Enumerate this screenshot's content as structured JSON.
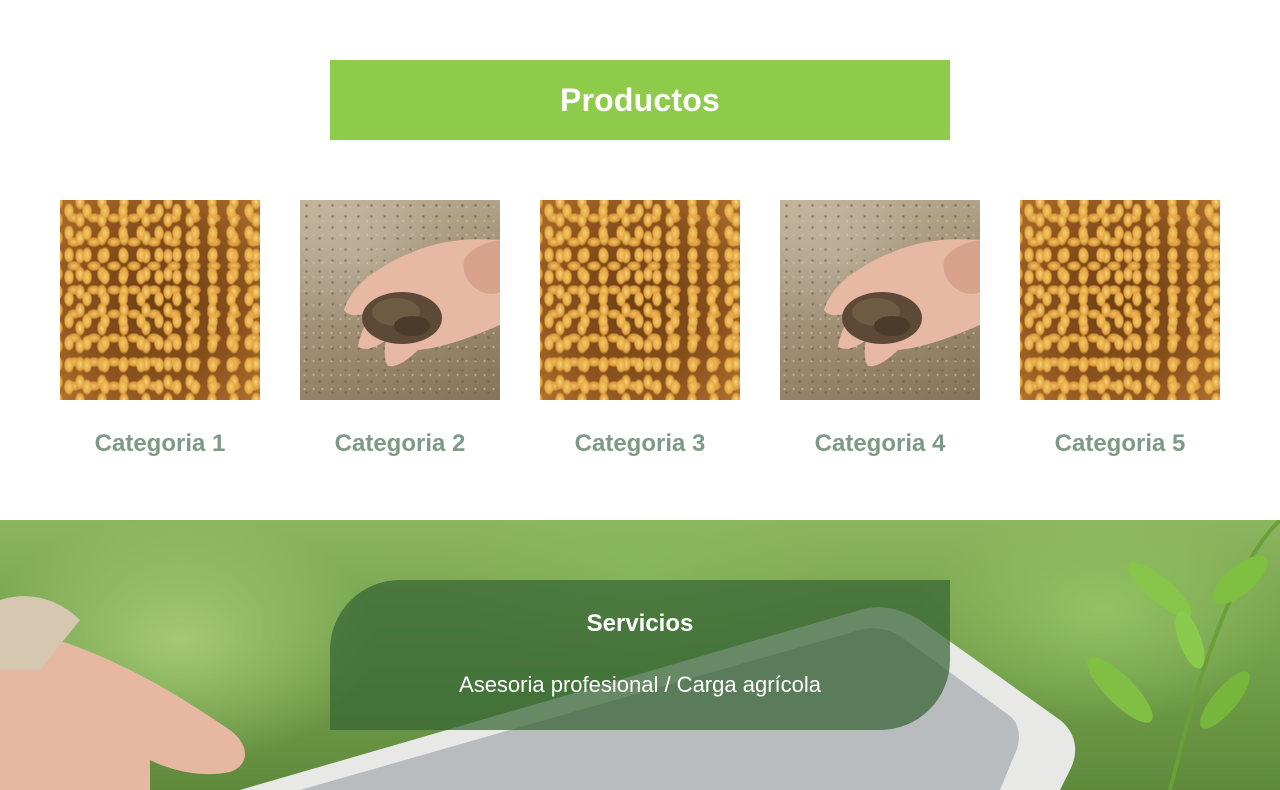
{
  "products": {
    "title": "Productos",
    "categories": [
      {
        "label": "Categoria 1",
        "image": "wheat-grain"
      },
      {
        "label": "Categoria 2",
        "image": "soil-in-hand"
      },
      {
        "label": "Categoria 3",
        "image": "wheat-grain"
      },
      {
        "label": "Categoria 4",
        "image": "soil-in-hand"
      },
      {
        "label": "Categoria 5",
        "image": "wheat-grain"
      }
    ]
  },
  "services": {
    "title": "Servicios",
    "subtitle": "Asesoria profesional / Carga agrícola",
    "background_image": "tablet-in-field"
  },
  "colors": {
    "title_bar": "#8fcb4b",
    "category_label": "#7e9a86",
    "services_card": "#346434"
  }
}
